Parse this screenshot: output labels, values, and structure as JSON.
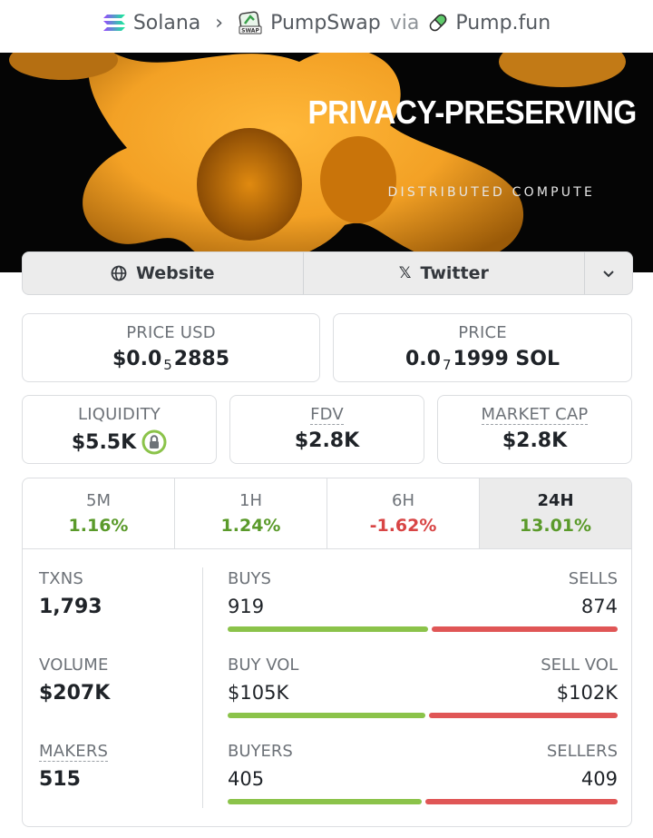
{
  "breadcrumb": {
    "chain": "Solana",
    "separator": "›",
    "dex": "PumpSwap",
    "via": "via",
    "source": "Pump.fun"
  },
  "banner": {
    "title": "PRIVACY-PRESERVING",
    "subtitle": "DISTRIBUTED COMPUTE"
  },
  "links": {
    "website": "Website",
    "twitter": "Twitter",
    "twitter_icon": "𝕏"
  },
  "price_usd": {
    "label": "PRICE USD",
    "prefix": "$0.0",
    "zeros": "5",
    "digits": "2885"
  },
  "price_sol": {
    "label": "PRICE",
    "prefix": "0.0",
    "zeros": "7",
    "digits": "1999 SOL"
  },
  "liquidity": {
    "label": "LIQUIDITY",
    "value": "$5.5K"
  },
  "fdv": {
    "label": "FDV",
    "value": "$2.8K"
  },
  "market_cap": {
    "label": "MARKET CAP",
    "value": "$2.8K"
  },
  "timeframes": [
    {
      "label": "5M",
      "change": "1.16%"
    },
    {
      "label": "1H",
      "change": "1.24%"
    },
    {
      "label": "6H",
      "change": "-1.62%"
    },
    {
      "label": "24H",
      "change": "13.01%"
    }
  ],
  "stats": {
    "txns": {
      "label": "TXNS",
      "value": "1,793"
    },
    "volume": {
      "label": "VOLUME",
      "value": "$207K"
    },
    "makers": {
      "label": "MAKERS",
      "value": "515"
    },
    "buys": {
      "label": "BUYS",
      "value": "919",
      "share": 0.513
    },
    "sells": {
      "label": "SELLS",
      "value": "874"
    },
    "buy_vol": {
      "label": "BUY VOL",
      "value": "$105K",
      "share": 0.507
    },
    "sell_vol": {
      "label": "SELL VOL",
      "value": "$102K"
    },
    "buyers": {
      "label": "BUYERS",
      "value": "405",
      "share": 0.498
    },
    "sellers": {
      "label": "SELLERS",
      "value": "409"
    }
  },
  "colors": {
    "positive": "#5a9a2a",
    "negative": "#d84545",
    "buy_bar": "#8bc34a",
    "sell_bar": "#e05656",
    "banner_orange": "#f0a020"
  },
  "icons": {
    "solana": "solana-icon",
    "pumpswap": "pumpswap-icon",
    "pumpfun": "pill-icon",
    "globe": "globe-icon",
    "x": "x-icon",
    "chevron": "chevron-down-icon",
    "lock": "lock-icon"
  }
}
